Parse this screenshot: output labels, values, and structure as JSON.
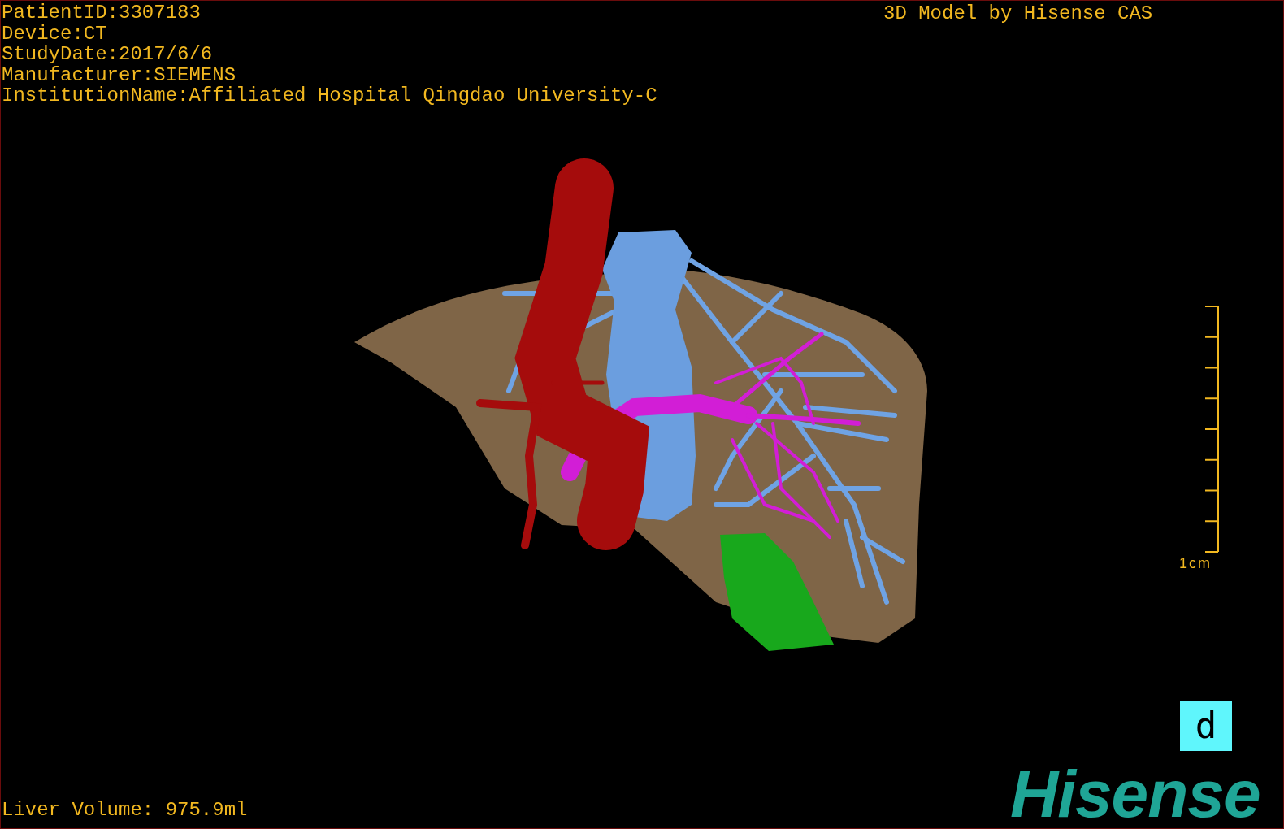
{
  "patient_info": [
    "PatientID:3307183",
    "Device:CT",
    "StudyDate:2017/6/6",
    "Manufacturer:SIEMENS",
    "InstitutionName:Affiliated Hospital Qingdao University-C"
  ],
  "title": "3D Model by Hisense CAS",
  "scale_bar": {
    "label": "1cm"
  },
  "orientation_cube": {
    "label": "d"
  },
  "liver_volume": "Liver Volume: 975.9ml",
  "logo": "Hisense"
}
